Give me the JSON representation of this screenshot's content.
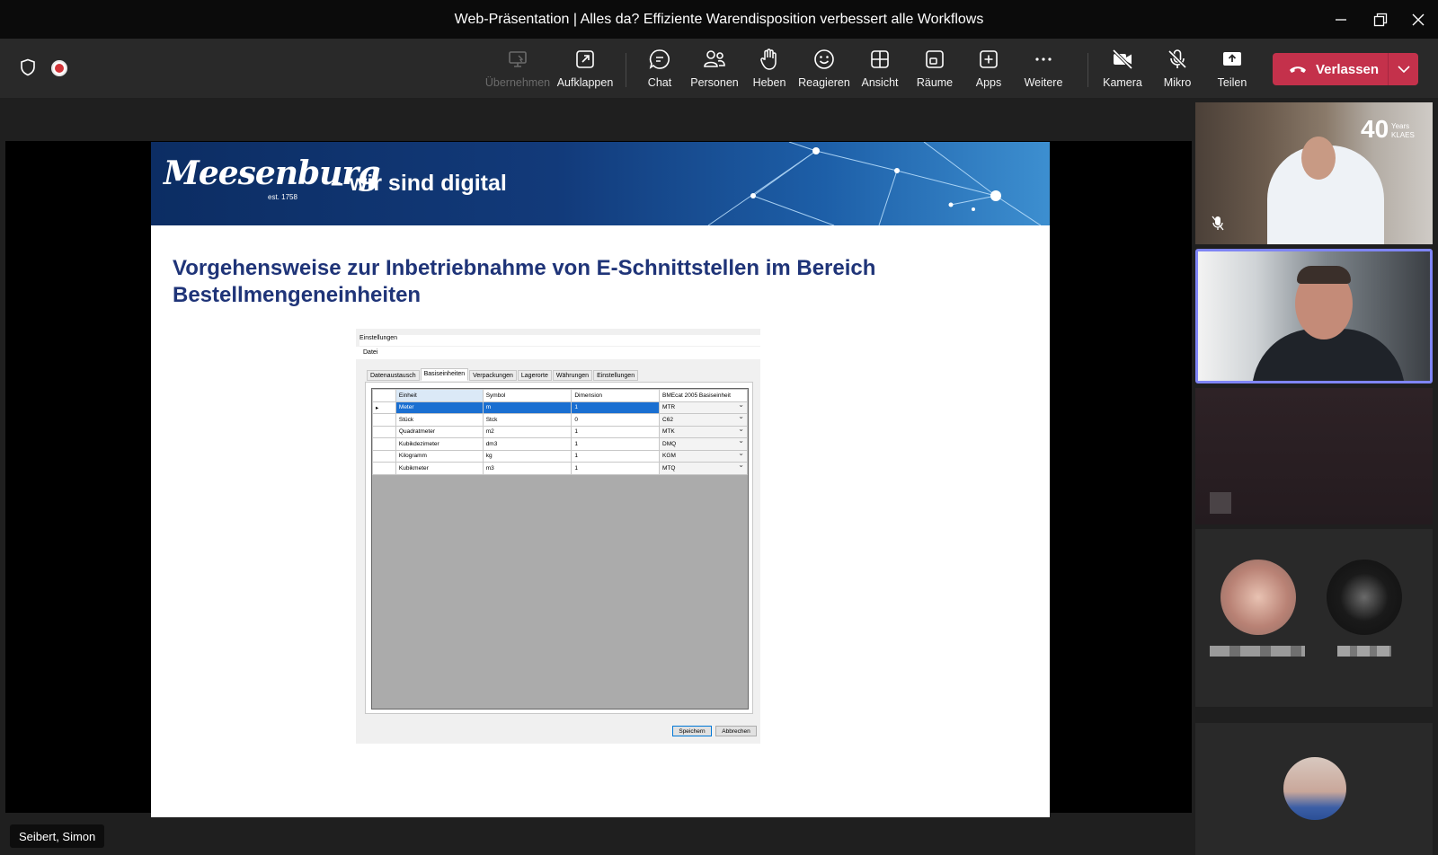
{
  "window": {
    "title": "Web-Präsentation | Alles da? Effiziente Warendisposition verbessert alle Workflows"
  },
  "toolbar": {
    "buttons": [
      {
        "label": "Übernehmen",
        "icon": "take-control-icon",
        "enabled": false
      },
      {
        "label": "Aufklappen",
        "icon": "pop-out-icon",
        "enabled": true
      },
      {
        "label": "Chat",
        "icon": "chat-icon",
        "enabled": true
      },
      {
        "label": "Personen",
        "icon": "people-icon",
        "enabled": true
      },
      {
        "label": "Heben",
        "icon": "raise-hand-icon",
        "enabled": true
      },
      {
        "label": "Reagieren",
        "icon": "react-icon",
        "enabled": true
      },
      {
        "label": "Ansicht",
        "icon": "view-icon",
        "enabled": true
      },
      {
        "label": "Räume",
        "icon": "rooms-icon",
        "enabled": true
      },
      {
        "label": "Apps",
        "icon": "apps-icon",
        "enabled": true
      },
      {
        "label": "Weitere",
        "icon": "more-icon",
        "enabled": true
      },
      {
        "label": "Kamera",
        "icon": "camera-off-icon",
        "enabled": true
      },
      {
        "label": "Mikro",
        "icon": "mic-off-icon",
        "enabled": true
      },
      {
        "label": "Teilen",
        "icon": "share-icon",
        "enabled": true
      }
    ],
    "leave_label": "Verlassen",
    "leave_color": "#c4314b"
  },
  "slide": {
    "logo_text": "Meesenburg",
    "logo_est": "est. 1758",
    "tagline": "–  wir sind digital",
    "title": "Vorgehensweise zur Inbetriebnahme von E-Schnittstellen im Bereich Bestellmengeneinheiten",
    "title_color": "#1f3478"
  },
  "dialog": {
    "title": "Einstellungen",
    "menu": "Datei",
    "tabs": [
      "Datenaustausch",
      "Basiseinheiten",
      "Verpackungen",
      "Lagerorte",
      "Währungen",
      "Einstellungen"
    ],
    "active_tab": "Basiseinheiten",
    "columns": [
      "Einheit",
      "Symbol",
      "Dimension",
      "BMEcat 2005 Basiseinheit"
    ],
    "rows": [
      {
        "marker": "▸",
        "einheit": "Meter",
        "symbol": "m",
        "dimension": "1",
        "bmecat": "MTR"
      },
      {
        "marker": "",
        "einheit": "Stück",
        "symbol": "Stck",
        "dimension": "0",
        "bmecat": "C62"
      },
      {
        "marker": "",
        "einheit": "Quadratmeter",
        "symbol": "m2",
        "dimension": "1",
        "bmecat": "MTK"
      },
      {
        "marker": "",
        "einheit": "Kubikdezimeter",
        "symbol": "dm3",
        "dimension": "1",
        "bmecat": "DMQ"
      },
      {
        "marker": "",
        "einheit": "Kilogramm",
        "symbol": "kg",
        "dimension": "1",
        "bmecat": "KGM"
      },
      {
        "marker": "",
        "einheit": "Kubikmeter",
        "symbol": "m3",
        "dimension": "1",
        "bmecat": "MTQ"
      }
    ],
    "save_label": "Speichern",
    "cancel_label": "Abbrechen"
  },
  "presenter_name": "Seibert, Simon",
  "participants": {
    "tile1_watermark_big": "40",
    "tile1_watermark_small": "Years KLAES"
  }
}
